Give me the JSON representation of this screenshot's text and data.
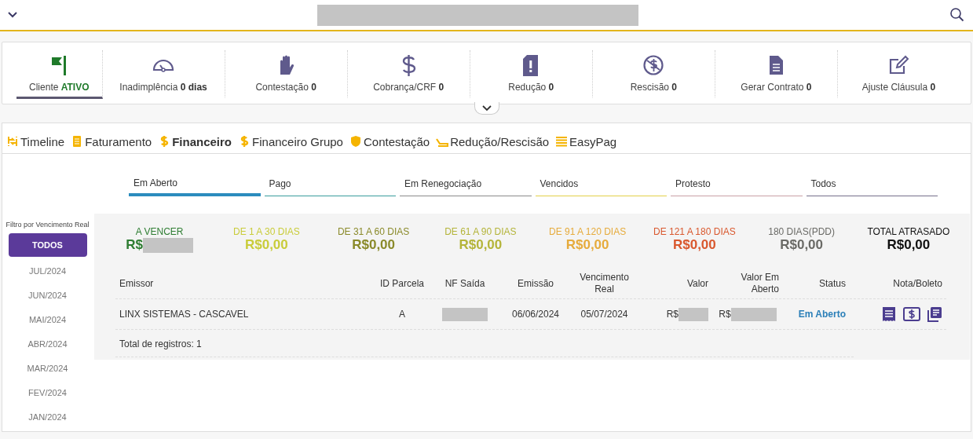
{
  "header": {
    "title_redacted": true
  },
  "indicators": [
    {
      "label": "Cliente",
      "value": "ATIVO",
      "selected": true
    },
    {
      "label": "Inadimplência",
      "value": "0 dias",
      "selected": false
    },
    {
      "label": "Contestação",
      "value": "0",
      "selected": false
    },
    {
      "label": "Cobrança/CRF",
      "value": "0",
      "selected": false
    },
    {
      "label": "Redução",
      "value": "0",
      "selected": false
    },
    {
      "label": "Rescisão",
      "value": "0",
      "selected": false
    },
    {
      "label": "Gerar Contrato",
      "value": "0",
      "selected": false
    },
    {
      "label": "Ajuste Cláusula",
      "value": "0",
      "selected": false
    }
  ],
  "tabs": [
    {
      "label": "Timeline",
      "selected": false
    },
    {
      "label": "Faturamento",
      "selected": false
    },
    {
      "label": "Financeiro",
      "selected": true
    },
    {
      "label": "Financeiro Grupo",
      "selected": false
    },
    {
      "label": "Contestação",
      "selected": false
    },
    {
      "label": "Redução/Rescisão",
      "selected": false
    },
    {
      "label": "EasyPag",
      "selected": false
    }
  ],
  "subtabs": [
    {
      "label": "Em Aberto",
      "selected": true,
      "color": "#2b8cbe"
    },
    {
      "label": "Pago",
      "selected": false,
      "color": "#3a9c9c"
    },
    {
      "label": "Em Renegociação",
      "selected": false,
      "color": "#8a8a8a"
    },
    {
      "label": "Vencidos",
      "selected": false,
      "color": "#e2d04a"
    },
    {
      "label": "Protesto",
      "selected": false,
      "color": "#c9a0a6"
    },
    {
      "label": "Todos",
      "selected": false,
      "color": "#75708a"
    }
  ],
  "filter": {
    "title": "Filtro por Vencimento Real",
    "items": [
      {
        "label": "TODOS",
        "selected": true
      },
      {
        "label": "JUL/2024",
        "selected": false
      },
      {
        "label": "JUN/2024",
        "selected": false
      },
      {
        "label": "MAI/2024",
        "selected": false
      },
      {
        "label": "ABR/2024",
        "selected": false
      },
      {
        "label": "MAR/2024",
        "selected": false
      },
      {
        "label": "FEV/2024",
        "selected": false
      },
      {
        "label": "JAN/2024",
        "selected": false
      }
    ]
  },
  "summary": [
    {
      "label": "A VENCER",
      "amount": "R$",
      "redacted": true,
      "color": "#2e7d32"
    },
    {
      "label": "DE 1 A 30 DIAS",
      "amount": "R$0,00",
      "redacted": false,
      "color": "#c9cc3a"
    },
    {
      "label": "DE 31 A 60 DIAS",
      "amount": "R$0,00",
      "redacted": false,
      "color": "#8a8a2a"
    },
    {
      "label": "DE 61 A 90 DIAS",
      "amount": "R$0,00",
      "redacted": false,
      "color": "#b4b43a"
    },
    {
      "label": "DE 91 A 120 DIAS",
      "amount": "R$0,00",
      "redacted": false,
      "color": "#e6ab3c"
    },
    {
      "label": "DE 121 A 180 DIAS",
      "amount": "R$0,00",
      "redacted": false,
      "color": "#d9582e"
    },
    {
      "label": "180 DIAS(PDD)",
      "amount": "R$0,00",
      "redacted": false,
      "color": "#6a6a66"
    },
    {
      "label": "TOTAL ATRASADO",
      "amount": "R$0,00",
      "redacted": false,
      "color": "#111111"
    }
  ],
  "table": {
    "columns": [
      "Emissor",
      "ID Parcela",
      "NF Saída",
      "Emissão",
      "Vencimento Real",
      "Valor",
      "Valor Em Aberto",
      "Status",
      "Nota/Boleto"
    ],
    "rows": [
      {
        "emissor": "LINX SISTEMAS - CASCAVEL",
        "id_parcela": "A",
        "nf_saida_redacted": true,
        "emissao": "06/06/2024",
        "vencimento_real": "05/07/2024",
        "valor": "R$",
        "valor_redacted": true,
        "valor_em_aberto": "R$",
        "valor_em_aberto_redacted": true,
        "status": "Em Aberto"
      }
    ],
    "total": "Total de registros: 1"
  }
}
